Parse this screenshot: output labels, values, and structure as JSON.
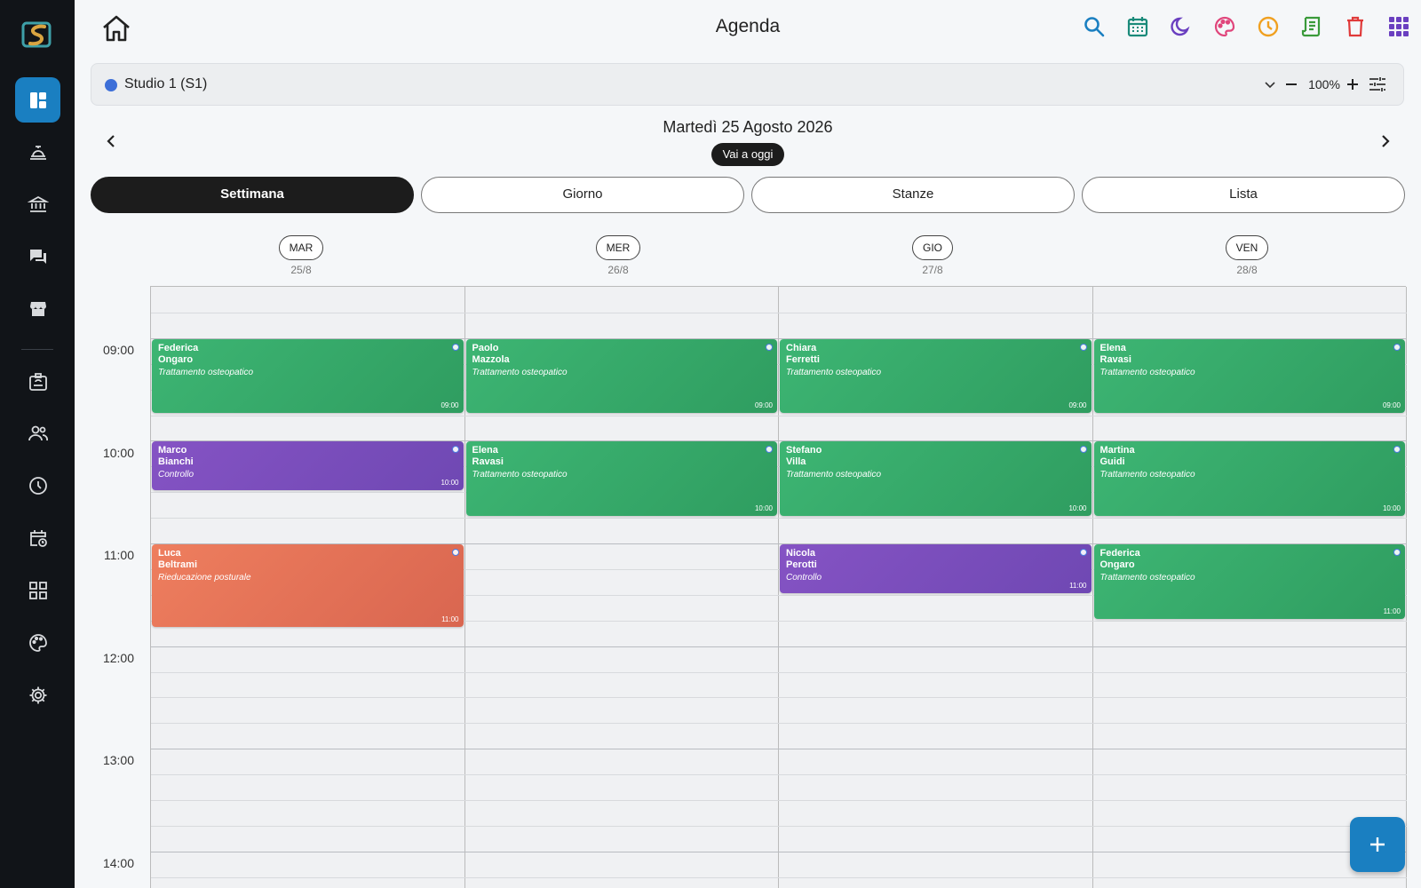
{
  "app": {
    "title": "Agenda"
  },
  "sidebar": {
    "items": [
      {
        "name": "dashboard",
        "icon": "dashboard-icon",
        "active": true
      },
      {
        "name": "reception",
        "icon": "reception-bell-icon"
      },
      {
        "name": "bank",
        "icon": "bank-icon"
      },
      {
        "name": "chat",
        "icon": "chat-icon"
      },
      {
        "name": "store",
        "icon": "store-icon"
      },
      {
        "name": "badge",
        "icon": "id-badge-icon"
      },
      {
        "name": "people",
        "icon": "people-icon"
      },
      {
        "name": "clock",
        "icon": "clock-icon"
      },
      {
        "name": "calendar-clock",
        "icon": "calendar-clock-icon"
      },
      {
        "name": "widgets",
        "icon": "grid-icon"
      },
      {
        "name": "palette",
        "icon": "palette-icon"
      },
      {
        "name": "settings",
        "icon": "gear-icon"
      }
    ]
  },
  "toolbar": {
    "icons": [
      {
        "name": "search-icon",
        "color": "#1a7fc1"
      },
      {
        "name": "calendar-icon",
        "color": "#1a8a7a"
      },
      {
        "name": "moon-icon",
        "color": "#6a3fc0"
      },
      {
        "name": "palette-icon",
        "color": "#e0457b"
      },
      {
        "name": "clock-icon",
        "color": "#f0a020"
      },
      {
        "name": "receipt-icon",
        "color": "#3a9a3a"
      },
      {
        "name": "trash-icon",
        "color": "#e03a3a"
      },
      {
        "name": "apps-grid-icon",
        "color": "#6a3fc0"
      }
    ]
  },
  "studio": {
    "name": "Studio 1 (S1)",
    "color": "#3d6fd8",
    "zoom": "100%"
  },
  "date_nav": {
    "current_date": "Martedì 25 Agosto 2026",
    "today_label": "Vai a oggi"
  },
  "view_tabs": [
    {
      "label": "Settimana",
      "active": true
    },
    {
      "label": "Giorno",
      "active": false
    },
    {
      "label": "Stanze",
      "active": false
    },
    {
      "label": "Lista",
      "active": false
    }
  ],
  "days": [
    {
      "abbr": "MAR",
      "date": "25/8"
    },
    {
      "abbr": "MER",
      "date": "26/8"
    },
    {
      "abbr": "GIO",
      "date": "27/8"
    },
    {
      "abbr": "VEN",
      "date": "28/8"
    }
  ],
  "hours": [
    "09:00",
    "10:00",
    "11:00",
    "12:00",
    "13:00",
    "14:00"
  ],
  "colors": {
    "green": "#35a866",
    "purple": "#7a4ebd",
    "orange": "#e47257",
    "accent": "#1a7fc1"
  },
  "events": [
    {
      "day": 0,
      "start": "09:00",
      "duration_min": 45,
      "first": "Federica",
      "last": "Ongaro",
      "type": "Trattamento osteopatico",
      "time": "09:00",
      "color": "green"
    },
    {
      "day": 1,
      "start": "09:00",
      "duration_min": 45,
      "first": "Paolo",
      "last": "Mazzola",
      "type": "Trattamento osteopatico",
      "time": "09:00",
      "color": "green"
    },
    {
      "day": 2,
      "start": "09:00",
      "duration_min": 45,
      "first": "Chiara",
      "last": "Ferretti",
      "type": "Trattamento osteopatico",
      "time": "09:00",
      "color": "green"
    },
    {
      "day": 3,
      "start": "09:00",
      "duration_min": 45,
      "first": "Elena",
      "last": "Ravasi",
      "type": "Trattamento osteopatico",
      "time": "09:00",
      "color": "green"
    },
    {
      "day": 0,
      "start": "10:00",
      "duration_min": 30,
      "first": "Marco",
      "last": "Bianchi",
      "type": "Controllo",
      "time": "10:00",
      "color": "purple"
    },
    {
      "day": 1,
      "start": "10:00",
      "duration_min": 45,
      "first": "Elena",
      "last": "Ravasi",
      "type": "Trattamento osteopatico",
      "time": "10:00",
      "color": "green"
    },
    {
      "day": 2,
      "start": "10:00",
      "duration_min": 45,
      "first": "Stefano",
      "last": "Villa",
      "type": "Trattamento osteopatico",
      "time": "10:00",
      "color": "green"
    },
    {
      "day": 3,
      "start": "10:00",
      "duration_min": 45,
      "first": "Martina",
      "last": "Guidi",
      "type": "Trattamento osteopatico",
      "time": "10:00",
      "color": "green"
    },
    {
      "day": 0,
      "start": "11:00",
      "duration_min": 50,
      "first": "Luca",
      "last": "Beltrami",
      "type": "Rieducazione posturale",
      "time": "11:00",
      "color": "orange"
    },
    {
      "day": 2,
      "start": "11:00",
      "duration_min": 30,
      "first": "Nicola",
      "last": "Perotti",
      "type": "Controllo",
      "time": "11:00",
      "color": "purple"
    },
    {
      "day": 3,
      "start": "11:00",
      "duration_min": 45,
      "first": "Federica",
      "last": "Ongaro",
      "type": "Trattamento osteopatico",
      "time": "11:00",
      "color": "green"
    }
  ]
}
